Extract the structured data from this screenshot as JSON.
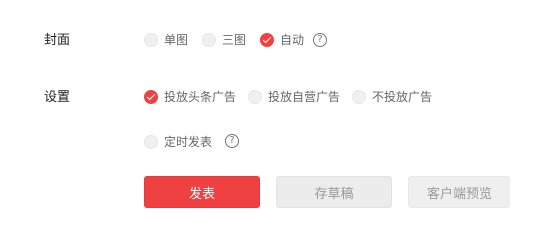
{
  "cover": {
    "label": "封面",
    "options": [
      {
        "label": "单图",
        "checked": false
      },
      {
        "label": "三图",
        "checked": false
      },
      {
        "label": "自动",
        "checked": true
      }
    ]
  },
  "settings": {
    "label": "设置",
    "options": [
      {
        "label": "投放头条广告",
        "checked": true
      },
      {
        "label": "投放自营广告",
        "checked": false
      },
      {
        "label": "不投放广告",
        "checked": false
      }
    ],
    "schedule": {
      "label": "定时发表",
      "checked": false
    }
  },
  "actions": {
    "publish": "发表",
    "draft": "存草稿",
    "preview": "客户端预览"
  },
  "help_glyph": "?",
  "colors": {
    "accent": "#f04142"
  }
}
